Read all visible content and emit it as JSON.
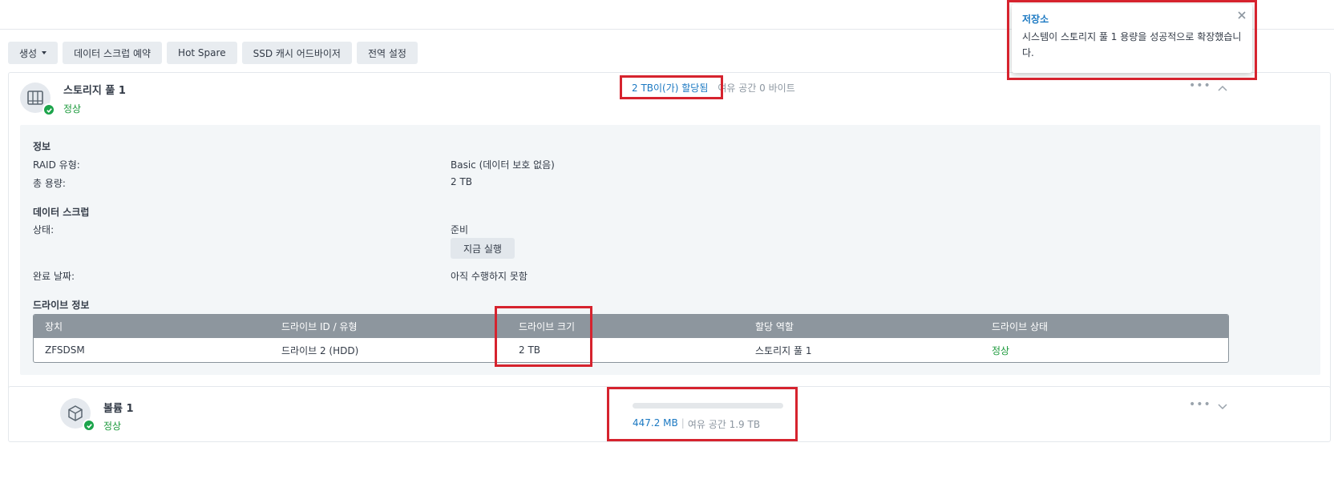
{
  "toolbar": {
    "create": "생성",
    "scrub_schedule": "데이터 스크럽 예약",
    "hot_spare": "Hot Spare",
    "ssd_cache": "SSD 캐시 어드바이저",
    "global_settings": "전역 설정"
  },
  "pool": {
    "name": "스토리지 풀 1",
    "status": "정상",
    "allocated": "2 TB이(가) 할당됨",
    "free": "여유 공간 0 바이트",
    "info": {
      "title": "정보",
      "raid_label": "RAID 유형:",
      "raid_value": "Basic (데이터 보호 없음)",
      "capacity_label": "총 용량:",
      "capacity_value": "2 TB"
    },
    "scrub": {
      "title": "데이터 스크럽",
      "state_label": "상태:",
      "state_value": "준비",
      "run_now": "지금 실행",
      "done_label": "완료 날짜:",
      "done_value": "아직 수행하지 못함"
    },
    "drives": {
      "title": "드라이브 정보",
      "headers": [
        "장치",
        "드라이브 ID / 유형",
        "드라이브 크기",
        "할당 역할",
        "드라이브 상태"
      ],
      "rows": [
        {
          "device": "ZFSDSM",
          "drive": "드라이브 2 (HDD)",
          "size": "2 TB",
          "role": "스토리지 풀 1",
          "status": "정상"
        }
      ]
    }
  },
  "volume": {
    "name": "볼륨 1",
    "status": "정상",
    "used": "447.2 MB",
    "separator": "|",
    "free": "여유 공간 1.9 TB",
    "usage_fraction": 0.0002
  },
  "toast": {
    "title": "저장소",
    "message": "시스템이 스토리지 풀 1 용량을 성공적으로 확장했습니다."
  },
  "colors": {
    "accent": "#1a78c2",
    "ok": "#1c9a3c",
    "highlight": "#d6232e"
  }
}
